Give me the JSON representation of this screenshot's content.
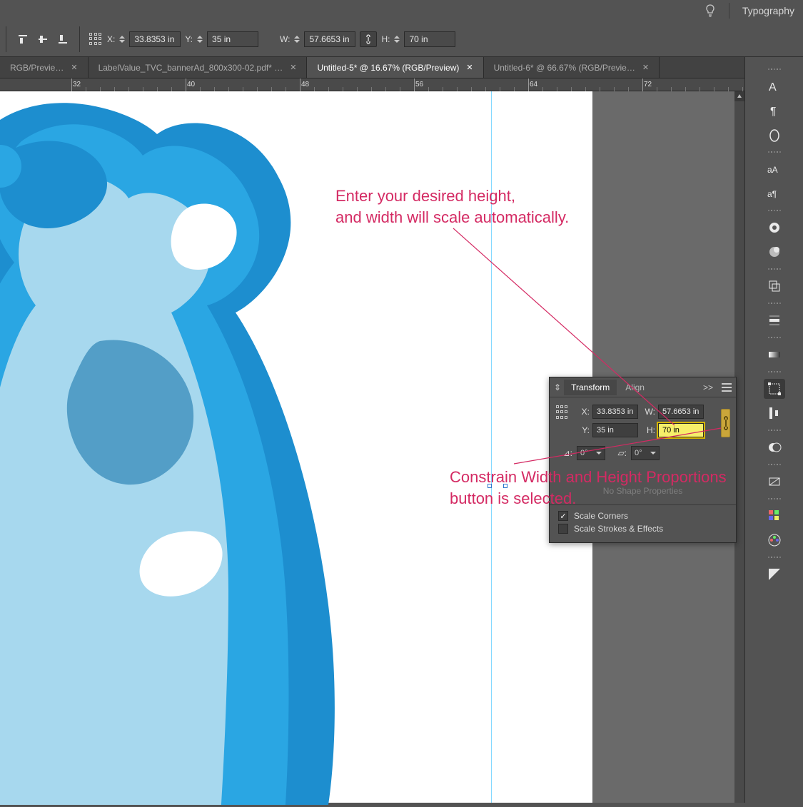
{
  "menubar": {
    "typography_label": "Typography"
  },
  "optionsbar": {
    "x_label": "X:",
    "x_value": "33.8353 in",
    "y_label": "Y:",
    "y_value": "35 in",
    "w_label": "W:",
    "w_value": "57.6653 in",
    "h_label": "H:",
    "h_value": "70 in"
  },
  "tabs": [
    {
      "label": "RGB/Previe…",
      "active": false
    },
    {
      "label": "LabelValue_TVC_bannerAd_800x300-02.pdf* …",
      "active": false
    },
    {
      "label": "Untitled-5* @ 16.67% (RGB/Preview)",
      "active": true
    },
    {
      "label": "Untitled-6* @ 66.67% (RGB/Previe…",
      "active": false
    }
  ],
  "ruler": {
    "ticks": [
      "32",
      "40",
      "48",
      "56",
      "64",
      "72"
    ]
  },
  "annotation": {
    "line1": "Enter your desired height,",
    "line2": "and width will scale automatically.",
    "line3": "Constrain Width and Height Proportions",
    "line4": "button is selected."
  },
  "transform": {
    "tab_transform": "Transform",
    "tab_align": "Align",
    "expand": ">>",
    "x_label": "X:",
    "x_value": "33.8353 in",
    "y_label": "Y:",
    "y_value": "35 in",
    "w_label": "W:",
    "w_value": "57.6653 in",
    "h_label": "H:",
    "h_value": "70 in",
    "angle_label": "0°",
    "shear_label": "0°",
    "no_shape": "No Shape Properties",
    "scale_corners": "Scale Corners",
    "scale_strokes": "Scale Strokes & Effects"
  }
}
